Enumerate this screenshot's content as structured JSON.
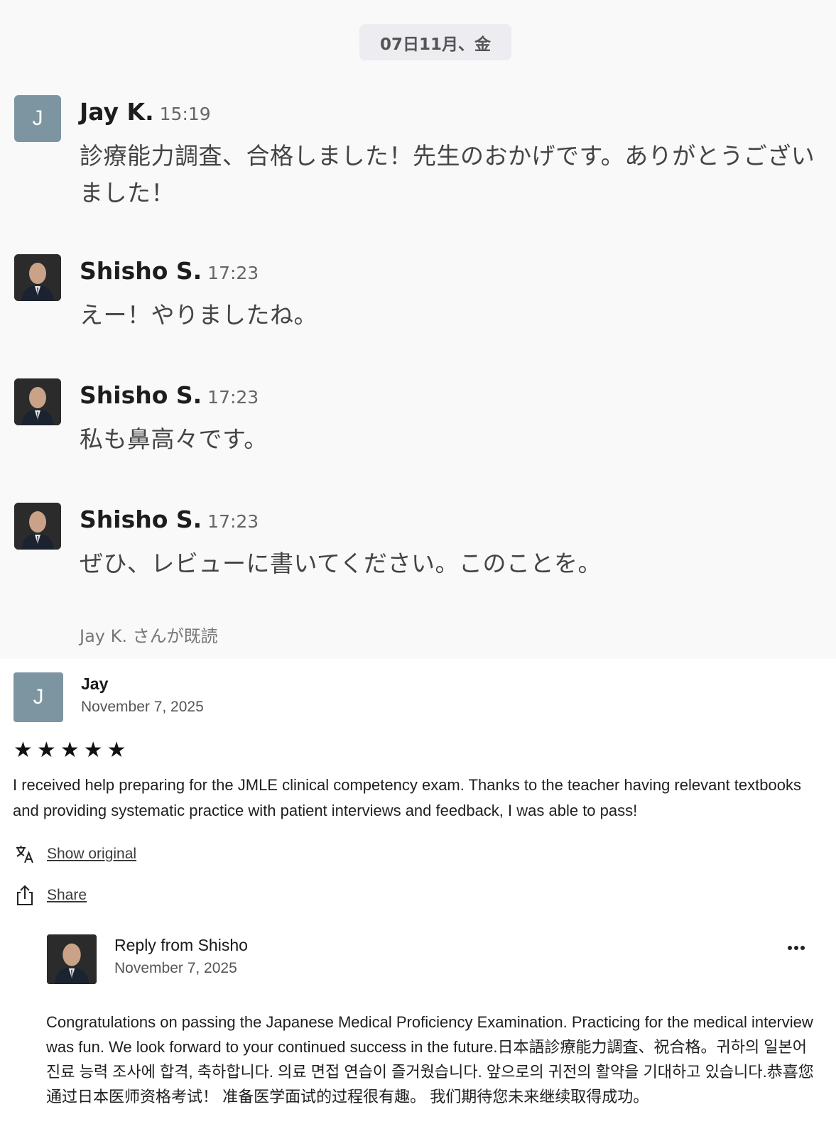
{
  "chat": {
    "date_label": "07日11月、金",
    "messages": [
      {
        "author": "Jay K.",
        "avatar_letter": "J",
        "time": "15:19",
        "text": "診療能力調査、合格しました！先生のおかげです。ありがとうございました！"
      },
      {
        "author": "Shisho S.",
        "time": "17:23",
        "text": "えー！やりましたね。"
      },
      {
        "author": "Shisho S.",
        "time": "17:23",
        "text": "私も鼻高々です。"
      },
      {
        "author": "Shisho S.",
        "time": "17:23",
        "text": "ぜひ、レビューに書いてください。このことを。"
      }
    ],
    "read_receipt": "Jay K. さんが既読"
  },
  "review": {
    "avatar_letter": "J",
    "author": "Jay",
    "date": "November 7, 2025",
    "rating": 5,
    "text": "I received help preparing for the JMLE clinical competency exam. Thanks to the teacher having relevant textbooks and providing systematic practice with patient interviews and feedback, I was able to pass!",
    "show_original_label": "Show original",
    "share_label": "Share",
    "icons": {
      "translate": "translate-icon",
      "share": "share-icon",
      "star": "star-icon"
    }
  },
  "reply": {
    "title": "Reply from Shisho",
    "date": "November 7, 2025",
    "text": "Congratulations on passing the Japanese Medical Proficiency Examination. Practicing for the medical interview was fun. We look forward to your continued success in the future.日本語診療能力調査、祝合格。귀하의 일본어 진료 능력 조사에 합격, 축하합니다. 의료 면접 연습이 즐거웠습니다. 앞으로의 귀전의 활약을 기대하고 있습니다.恭喜您通过日本医师资格考试！ 准备医学面试的过程很有趣。 我们期待您未来继续取得成功。"
  },
  "colors": {
    "chat_background": "#f9f9fa",
    "date_pill": "#ececf1",
    "letter_avatar": "#7d95a1"
  }
}
